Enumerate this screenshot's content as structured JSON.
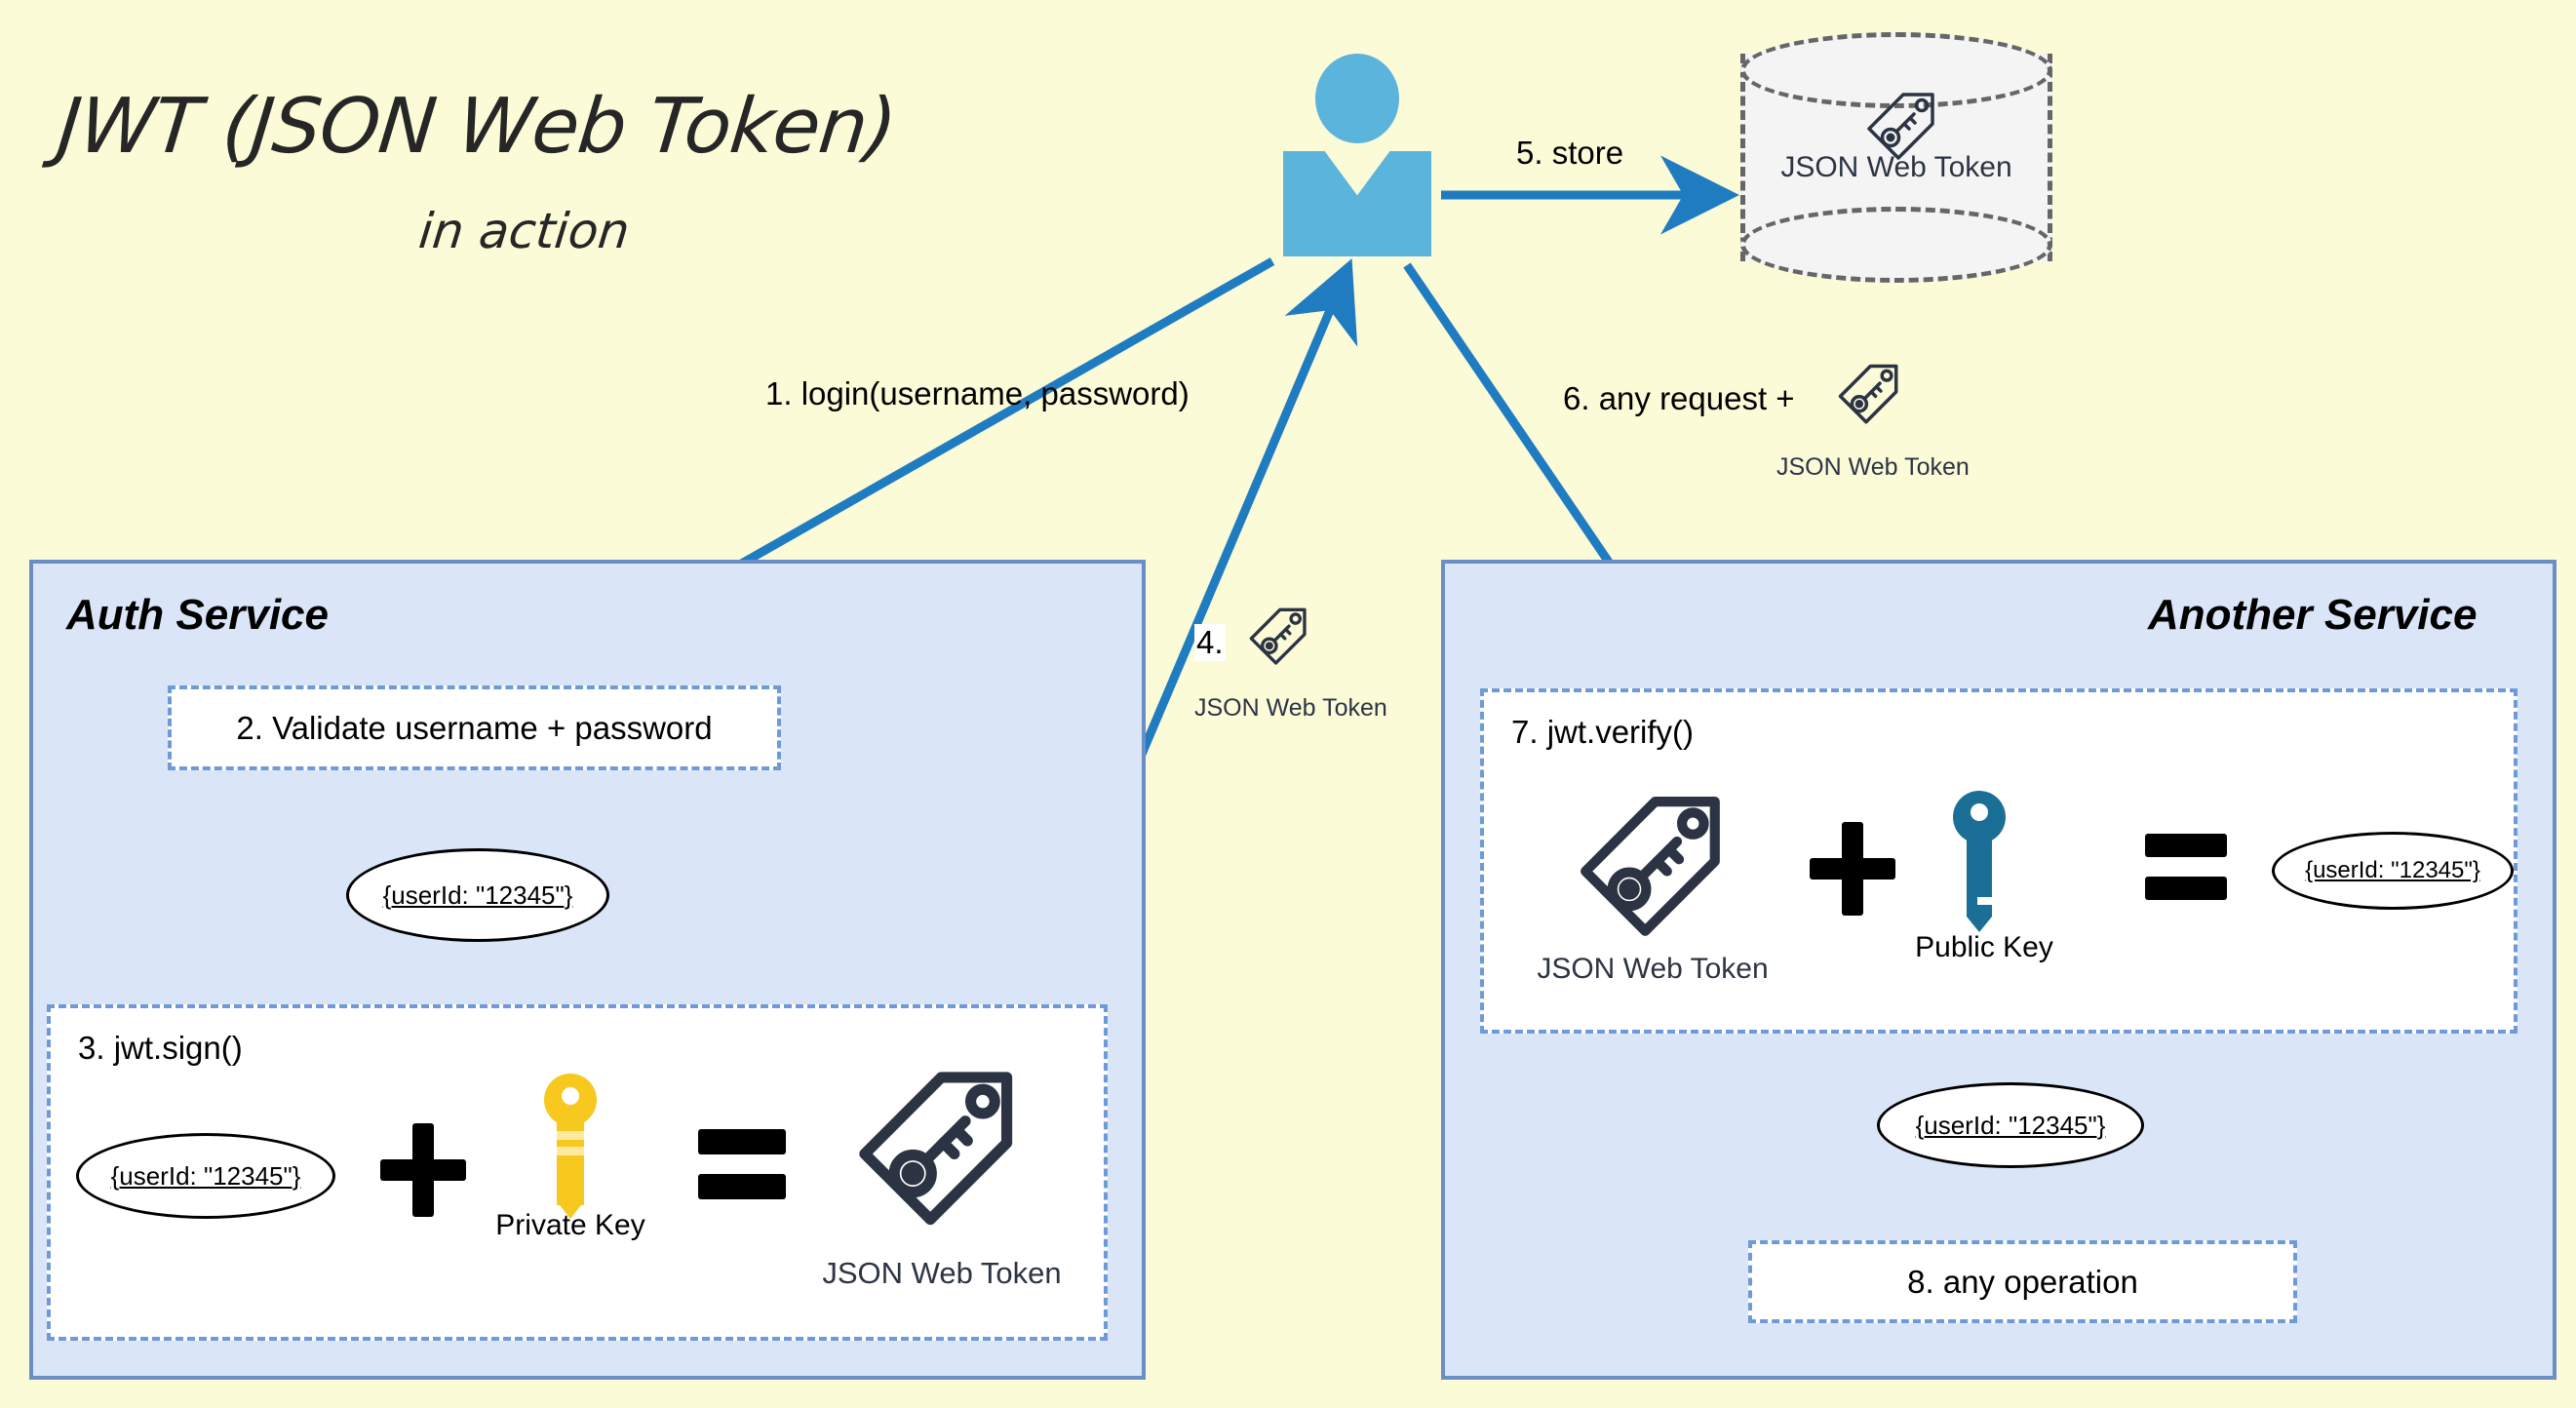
{
  "title": {
    "main": "JWT (JSON Web Token)",
    "sub": "in action"
  },
  "colors": {
    "background": "#fbfbd8",
    "service_fill": "#dae5f7",
    "service_border": "#6b8fc4",
    "arrow_blue": "#1f7cc0",
    "user_blue": "#5bb4dc",
    "token_navy": "#2c3444",
    "private_key_yellow": "#f7c81e",
    "public_key_teal": "#1b6e96",
    "dashed_panel_border": "#6f9ad8",
    "db_fill": "#f4f4f4",
    "db_border": "#666666"
  },
  "actor": {
    "name": "user-figure",
    "icon": "person-icon"
  },
  "database": {
    "name": "token-store-database",
    "icon": "database-cylinder-icon",
    "token_icon": "jwt-tag-key-icon",
    "token_label": "JSON Web Token"
  },
  "steps": [
    {
      "id": 1,
      "label": "1. login(username, password)"
    },
    {
      "id": 2,
      "label": "2. Validate username + password"
    },
    {
      "id": 3,
      "label": "3. jwt.sign()"
    },
    {
      "id": 4,
      "label": "4."
    },
    {
      "id": 5,
      "label": "5. store"
    },
    {
      "id": 6,
      "label": "6. any request +"
    },
    {
      "id": 7,
      "label": "7. jwt.verify()"
    },
    {
      "id": 8,
      "label": "8. any operation"
    }
  ],
  "auth_service": {
    "title": "Auth Service",
    "validate_box": {
      "label": "2. Validate username + password"
    },
    "payload": "{userId: \"12345\"}",
    "sign_box": {
      "label": "3. jwt.sign()",
      "payload": "{userId: \"12345\"}",
      "plus": "+",
      "equals": "=",
      "key_caption": "Private Key",
      "key_icon": "private-key-icon",
      "token_caption": "JSON Web Token",
      "token_icon": "jwt-tag-key-icon"
    }
  },
  "another_service": {
    "title": "Another Service",
    "verify_box": {
      "label": "7. jwt.verify()",
      "token_caption": "JSON Web Token",
      "token_icon": "jwt-tag-key-icon",
      "plus": "+",
      "key_caption": "Public Key",
      "key_icon": "public-key-icon",
      "equals": "=",
      "payload": "{userId: \"12345\"}"
    },
    "payload": "{userId: \"12345\"}",
    "operation_box": {
      "label": "8. any operation"
    }
  },
  "flow_labels": {
    "step1": "1. login(username, password)",
    "step4_number": "4.",
    "step4_token_caption": "JSON Web Token",
    "step5": "5. store",
    "step6": "6. any request +",
    "step6_token_caption": "JSON Web Token"
  }
}
